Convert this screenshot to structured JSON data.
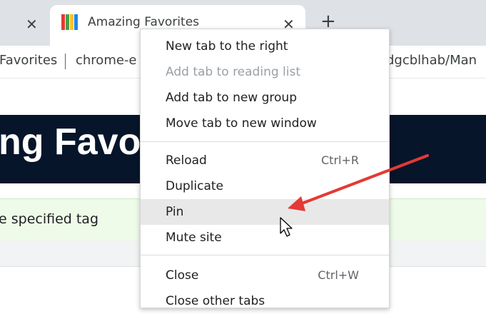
{
  "tabs": {
    "active_title": "Amazing Favorites",
    "close_glyph": "✕",
    "new_tab_glyph": "+"
  },
  "bookmarks": {
    "items": [
      "Favorites",
      "chrome-e",
      "dgcblhab/Man"
    ]
  },
  "page": {
    "header_text": "ng Favo",
    "info_text": "e specified tag"
  },
  "context_menu": {
    "items": [
      {
        "label": "New tab to the right",
        "shortcut": "",
        "enabled": true
      },
      {
        "label": "Add tab to reading list",
        "shortcut": "",
        "enabled": false
      },
      {
        "label": "Add tab to new group",
        "shortcut": "",
        "enabled": true
      },
      {
        "label": "Move tab to new window",
        "shortcut": "",
        "enabled": true
      },
      {
        "label": "Reload",
        "shortcut": "Ctrl+R",
        "enabled": true
      },
      {
        "label": "Duplicate",
        "shortcut": "",
        "enabled": true
      },
      {
        "label": "Pin",
        "shortcut": "",
        "enabled": true,
        "hovered": true
      },
      {
        "label": "Mute site",
        "shortcut": "",
        "enabled": true
      },
      {
        "label": "Close",
        "shortcut": "Ctrl+W",
        "enabled": true
      },
      {
        "label": "Close other tabs",
        "shortcut": "",
        "enabled": true
      }
    ]
  },
  "colors": {
    "tab_strip": "#dee1e6",
    "header_banner": "#06152a",
    "info_bar": "#eefbe8",
    "hover": "#e8e8e8",
    "annotation_arrow": "#e53935"
  },
  "icons": {
    "favicon": "books-icon",
    "cursor": "mouse-pointer-icon",
    "annotation": "red-arrow-annotation"
  }
}
